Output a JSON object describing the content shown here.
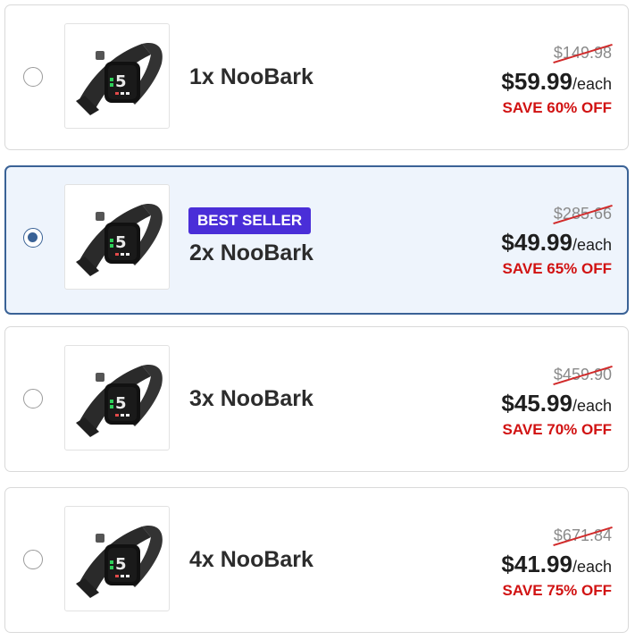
{
  "options": [
    {
      "title": "1x NooBark",
      "badge": "",
      "old_price": "$149.98",
      "price": "$59.99",
      "per": "/each",
      "save": "SAVE 60% OFF",
      "selected": false
    },
    {
      "title": "2x NooBark",
      "badge": "BEST SELLER",
      "old_price": "$285.66",
      "price": "$49.99",
      "per": "/each",
      "save": "SAVE 65% OFF",
      "selected": true
    },
    {
      "title": "3x NooBark",
      "badge": "",
      "old_price": "$459.90",
      "price": "$45.99",
      "per": "/each",
      "save": "SAVE 70% OFF",
      "selected": false
    },
    {
      "title": "4x NooBark",
      "badge": "",
      "old_price": "$671.84",
      "price": "$41.99",
      "per": "/each",
      "save": "SAVE 75% OFF",
      "selected": false
    }
  ],
  "colors": {
    "selected_border": "#3a6296",
    "selected_bg": "#eef4fc",
    "badge_bg": "#4a2ed8",
    "save_text": "#d11212",
    "strike_line": "#d12a2a"
  },
  "icons": [
    "dog-bark-collar-product-image",
    "radio-button"
  ]
}
